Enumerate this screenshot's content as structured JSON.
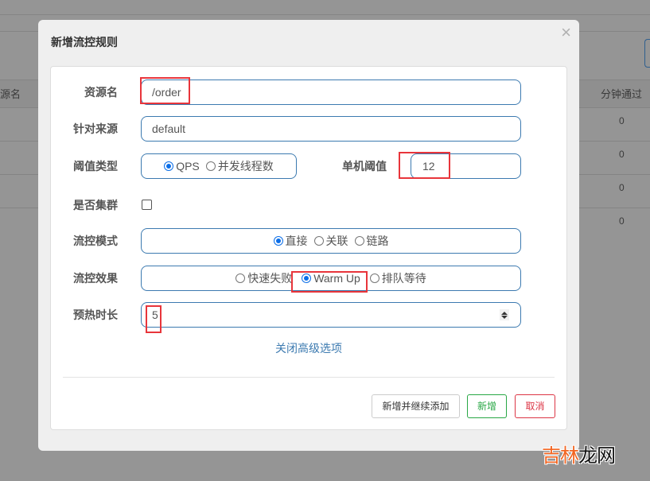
{
  "background_table": {
    "header_left": "源名",
    "header_right": "分钟通过",
    "rows": [
      "0",
      "0",
      "0",
      "0"
    ]
  },
  "modal": {
    "title": "新增流控规则",
    "close_icon": "close-icon",
    "form": {
      "resource_name": {
        "label": "资源名",
        "value": "/order"
      },
      "limit_app": {
        "label": "针对来源",
        "value": "default"
      },
      "grade": {
        "label": "阈值类型",
        "options": [
          "QPS",
          "并发线程数"
        ],
        "selected": "QPS"
      },
      "count": {
        "label": "单机阈值",
        "value": "12"
      },
      "cluster": {
        "label": "是否集群",
        "checked": false
      },
      "strategy": {
        "label": "流控模式",
        "options": [
          "直接",
          "关联",
          "链路"
        ],
        "selected": "直接"
      },
      "control_behavior": {
        "label": "流控效果",
        "options": [
          "快速失败",
          "Warm Up",
          "排队等待"
        ],
        "selected": "Warm Up"
      },
      "warm_up_period": {
        "label": "预热时长",
        "value": "5"
      }
    },
    "toggle_advanced_link": "关闭高级选项",
    "buttons": {
      "add_and_continue": "新增并继续添加",
      "add": "新增",
      "cancel": "取消"
    }
  },
  "colors": {
    "accent": "#3c7ab0",
    "success": "#28a745",
    "danger": "#dc3545",
    "highlight": "#e8353b",
    "radio_checked": "#0b6ee8"
  },
  "watermark": {
    "part1": "吉林",
    "part2": "龙网"
  }
}
